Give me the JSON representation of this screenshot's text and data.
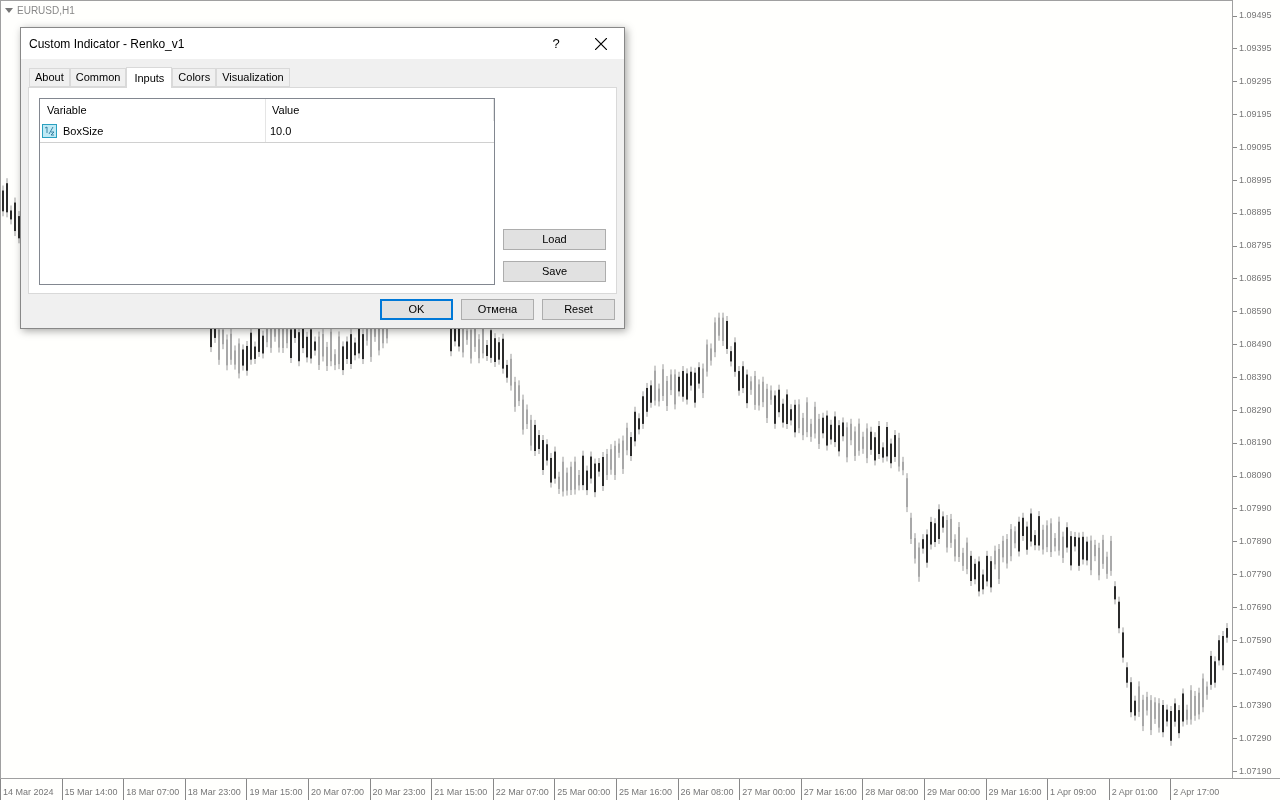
{
  "chart": {
    "symbol": "EURUSD,H1",
    "price_labels": [
      "1.09495",
      "1.09395",
      "1.09295",
      "1.09195",
      "1.09095",
      "1.08995",
      "1.08895",
      "1.08795",
      "1.08695",
      "1.08590",
      "1.08490",
      "1.08390",
      "1.08290",
      "1.08190",
      "1.08090",
      "1.07990",
      "1.07890",
      "1.07790",
      "1.07690",
      "1.07590",
      "1.07490",
      "1.07390",
      "1.07290",
      "1.07190"
    ],
    "time_labels": [
      "14 Mar 2024",
      "15 Mar 14:00",
      "18 Mar 07:00",
      "18 Mar 23:00",
      "19 Mar 15:00",
      "20 Mar 07:00",
      "20 Mar 23:00",
      "21 Mar 15:00",
      "22 Mar 07:00",
      "25 Mar 00:00",
      "25 Mar 16:00",
      "26 Mar 08:00",
      "27 Mar 00:00",
      "27 Mar 16:00",
      "28 Mar 08:00",
      "29 Mar 00:00",
      "29 Mar 16:00",
      "1 Apr 09:00",
      "2 Apr 01:00",
      "2 Apr 17:00"
    ]
  },
  "dialog": {
    "title": "Custom Indicator - Renko_v1",
    "help": "?",
    "tabs": [
      {
        "label": "About",
        "selected": false
      },
      {
        "label": "Common",
        "selected": false
      },
      {
        "label": "Inputs",
        "selected": true
      },
      {
        "label": "Colors",
        "selected": false
      },
      {
        "label": "Visualization",
        "selected": false
      }
    ],
    "table": {
      "columns": [
        "Variable",
        "Value"
      ],
      "rows": [
        {
          "variable": "BoxSize",
          "value": "10.0"
        }
      ]
    },
    "side_buttons": [
      "Load",
      "Save"
    ],
    "buttons": [
      {
        "label": "OK",
        "default": true
      },
      {
        "label": "Отмена",
        "default": false
      },
      {
        "label": "Reset",
        "default": false
      }
    ]
  }
}
